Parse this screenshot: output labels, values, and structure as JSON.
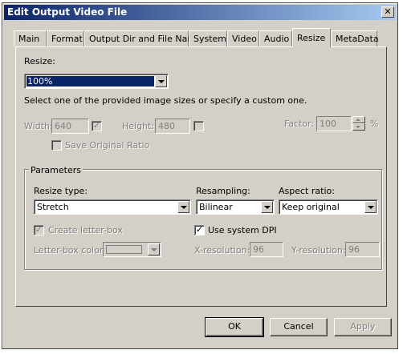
{
  "window": {
    "title": "Edit Output Video File",
    "close_glyph": "✕"
  },
  "tabs": [
    "Main",
    "Format",
    "Output Dir and File Name",
    "System",
    "Video",
    "Audio",
    "Resize",
    "MetaData"
  ],
  "active_tab": "Resize",
  "resize": {
    "label": "Resize:",
    "value": "100%",
    "hint": "Select one of the provided image sizes or specify a custom one.",
    "width_label": "Width:",
    "width_value": "640",
    "height_label": "Height:",
    "height_value": "480",
    "factor_label": "Factor:",
    "factor_value": "100",
    "percent": "%",
    "save_ratio_label": "Save Original Ratio",
    "width_checked": true,
    "height_checked": false,
    "save_ratio_checked": false
  },
  "parameters": {
    "title": "Parameters",
    "resize_type_label": "Resize type:",
    "resize_type_value": "Stretch",
    "resampling_label": "Resampling:",
    "resampling_value": "Bilinear",
    "aspect_label": "Aspect ratio:",
    "aspect_value": "Keep original",
    "letterbox_label": "Create letter-box",
    "letterbox_checked": true,
    "system_dpi_label": "Use system DPI",
    "system_dpi_checked": true,
    "letterbox_color_label": "Letter-box color:",
    "xres_label": "X-resolution:",
    "xres_value": "96",
    "yres_label": "Y-resolution:",
    "yres_value": "96"
  },
  "buttons": {
    "ok": "OK",
    "cancel": "Cancel",
    "apply": "Apply"
  },
  "check_glyph": "✓",
  "colors": {
    "title_start": "#0a246a",
    "title_end": "#a6caf0",
    "face": "#d4d0c8",
    "selection": "#0a246a"
  }
}
